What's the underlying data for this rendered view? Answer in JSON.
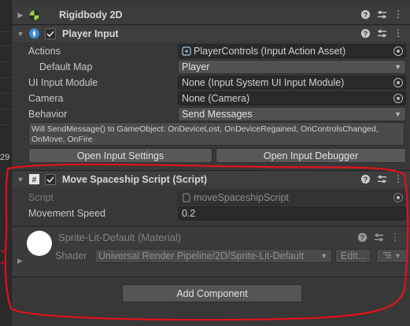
{
  "gutter": {
    "number": "29"
  },
  "rigidbody": {
    "title": "Rigidbody 2D"
  },
  "player_input": {
    "title": "Player Input",
    "rows": {
      "actions_label": "Actions",
      "actions_value": "PlayerControls (Input Action Asset)",
      "default_map_label": "Default Map",
      "default_map_value": "Player",
      "ui_module_label": "UI Input Module",
      "ui_module_value": "None (Input System UI Input Module)",
      "camera_label": "Camera",
      "camera_value": "None (Camera)",
      "behavior_label": "Behavior",
      "behavior_value": "Send Messages"
    },
    "help_text": "Will SendMessage() to GameObject: OnDeviceLost, OnDeviceRegained, OnControlsChanged, OnMove, OnFire",
    "open_settings_label": "Open Input Settings",
    "open_debugger_label": "Open Input Debugger"
  },
  "move_script": {
    "title": "Move Spaceship Script (Script)",
    "script_label": "Script",
    "script_value": "moveSpaceshipScript",
    "speed_label": "Movement Speed",
    "speed_value": "0.2"
  },
  "material": {
    "title": "Sprite-Lit-Default (Material)",
    "shader_label": "Shader",
    "shader_value": "Universal Render Pipeline/2D/Sprite-Lit-Default",
    "edit_label": "Edit..."
  },
  "add_component_label": "Add Component",
  "colors": {
    "annotation_red": "#e0121b",
    "panel_bg": "#383838",
    "header_bg": "#3e3e3e"
  }
}
